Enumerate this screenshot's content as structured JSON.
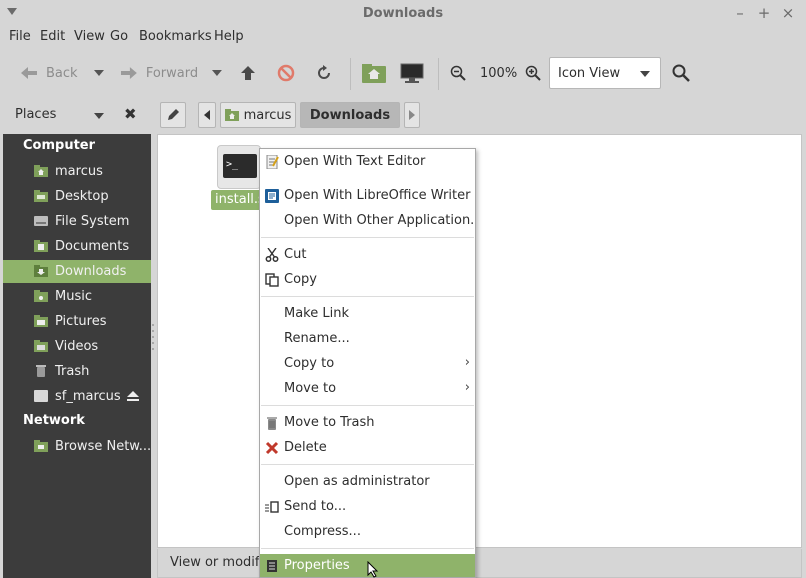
{
  "window": {
    "title": "Downloads"
  },
  "menubar": {
    "items": [
      "File",
      "Edit",
      "View",
      "Go",
      "Bookmarks",
      "Help"
    ]
  },
  "toolbar": {
    "back_label": "Back",
    "forward_label": "Forward",
    "zoom_level": "100%",
    "view_mode": "Icon View"
  },
  "places": {
    "label": "Places"
  },
  "pathbar": {
    "items": [
      "marcus",
      "Downloads"
    ]
  },
  "sidebar": {
    "computer_heading": "Computer",
    "computer_items": [
      "marcus",
      "Desktop",
      "File System",
      "Documents",
      "Downloads",
      "Music",
      "Pictures",
      "Videos",
      "Trash",
      "sf_marcus"
    ],
    "network_heading": "Network",
    "network_items": [
      "Browse Netw..."
    ]
  },
  "file": {
    "label": "install.s",
    "term_glyph": ">_"
  },
  "status": {
    "text": "View or modify t"
  },
  "context_menu": {
    "items": [
      {
        "label": "Open With Text Editor",
        "icon": "text-editor-icon"
      },
      {
        "label": "Open With LibreOffice Writer",
        "icon": "libreoffice-writer-icon"
      },
      {
        "label": "Open With Other Application...",
        "icon": ""
      },
      {
        "label": "Cut",
        "icon": "scissors-icon"
      },
      {
        "label": "Copy",
        "icon": "copy-icon"
      },
      {
        "label": "Make Link",
        "icon": ""
      },
      {
        "label": "Rename...",
        "icon": ""
      },
      {
        "label": "Copy to",
        "icon": "",
        "submenu": true
      },
      {
        "label": "Move to",
        "icon": "",
        "submenu": true
      },
      {
        "label": "Move to Trash",
        "icon": "trash-icon"
      },
      {
        "label": "Delete",
        "icon": "delete-x-icon"
      },
      {
        "label": "Open as administrator",
        "icon": ""
      },
      {
        "label": "Send to...",
        "icon": "send-to-icon"
      },
      {
        "label": "Compress...",
        "icon": ""
      },
      {
        "label": "Properties",
        "icon": "properties-icon",
        "highlighted": true
      }
    ]
  },
  "colors": {
    "accent": "#8fb36a",
    "sidebar_bg": "#3c3c3c",
    "window_bg": "#d6d6d6"
  }
}
